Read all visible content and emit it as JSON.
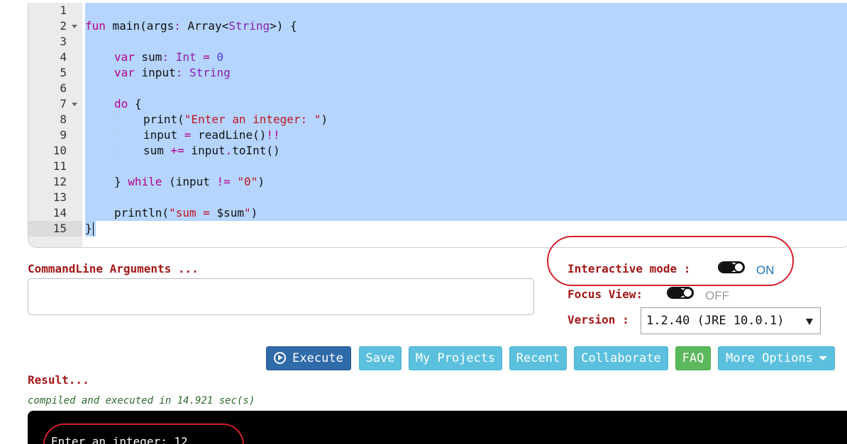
{
  "editor": {
    "line_numbers": [
      "1",
      "2",
      "3",
      "4",
      "5",
      "6",
      "7",
      "8",
      "9",
      "10",
      "11",
      "12",
      "13",
      "14",
      "15"
    ],
    "code": {
      "l2": {
        "fun": "fun",
        "rest1": " main(args",
        "colon": ":",
        "sp": " Array<",
        "String": "String",
        "tail": ">) {"
      },
      "l4": {
        "kw": "var",
        "name": " sum",
        "colon": ":",
        "type": " Int",
        "eq": " =",
        "val": " 0"
      },
      "l5": {
        "kw": "var",
        "name": " input",
        "colon": ":",
        "type": " String"
      },
      "l7": {
        "kw": "do",
        "rest": " {"
      },
      "l8": {
        "pre": "print(",
        "str": "\"Enter an integer: \"",
        "post": ")"
      },
      "l9": {
        "pre": "input ",
        "op": "=",
        "mid": " readLine()",
        "bang": "!!"
      },
      "l10": {
        "pre": "sum ",
        "op": "+=",
        "mid": " input",
        "dot": ".",
        "post": "toInt()"
      },
      "l12": {
        "pre": "} ",
        "kw": "while",
        "mid": " (input ",
        "op": "!=",
        "sp": " ",
        "str": "\"0\"",
        "post": ")"
      },
      "l14": {
        "pre": "println(",
        "str1": "\"sum = ",
        "var": "$sum",
        "str2": "\"",
        "post": ")"
      },
      "l15": "}"
    }
  },
  "args": {
    "label": "CommandLine Arguments ...",
    "value": ""
  },
  "options": {
    "interactive_label": "Interactive mode :",
    "interactive_state": "ON",
    "focus_label": "Focus View:",
    "focus_state": "OFF",
    "version_label": "Version :",
    "version_value": "1.2.40 (JRE 10.0.1)"
  },
  "buttons": {
    "execute": "Execute",
    "save": "Save",
    "my_projects": "My Projects",
    "recent": "Recent",
    "collaborate": "Collaborate",
    "faq": "FAQ",
    "more_options": "More Options"
  },
  "result": {
    "label": "Result...",
    "status": "compiled and executed in 14.921 sec(s)",
    "output_line": "Enter an integer: 12"
  },
  "colors": {
    "selection": "#b5d5ff",
    "label_red": "#a31717",
    "primary_button": "#2f6aa9",
    "info_button": "#5bc0de",
    "success_button": "#5cb85c",
    "annotation_red": "#d21f2b"
  },
  "icons": [
    "fold-arrow-icon",
    "execute-play-icon",
    "dropdown-caret-icon"
  ]
}
